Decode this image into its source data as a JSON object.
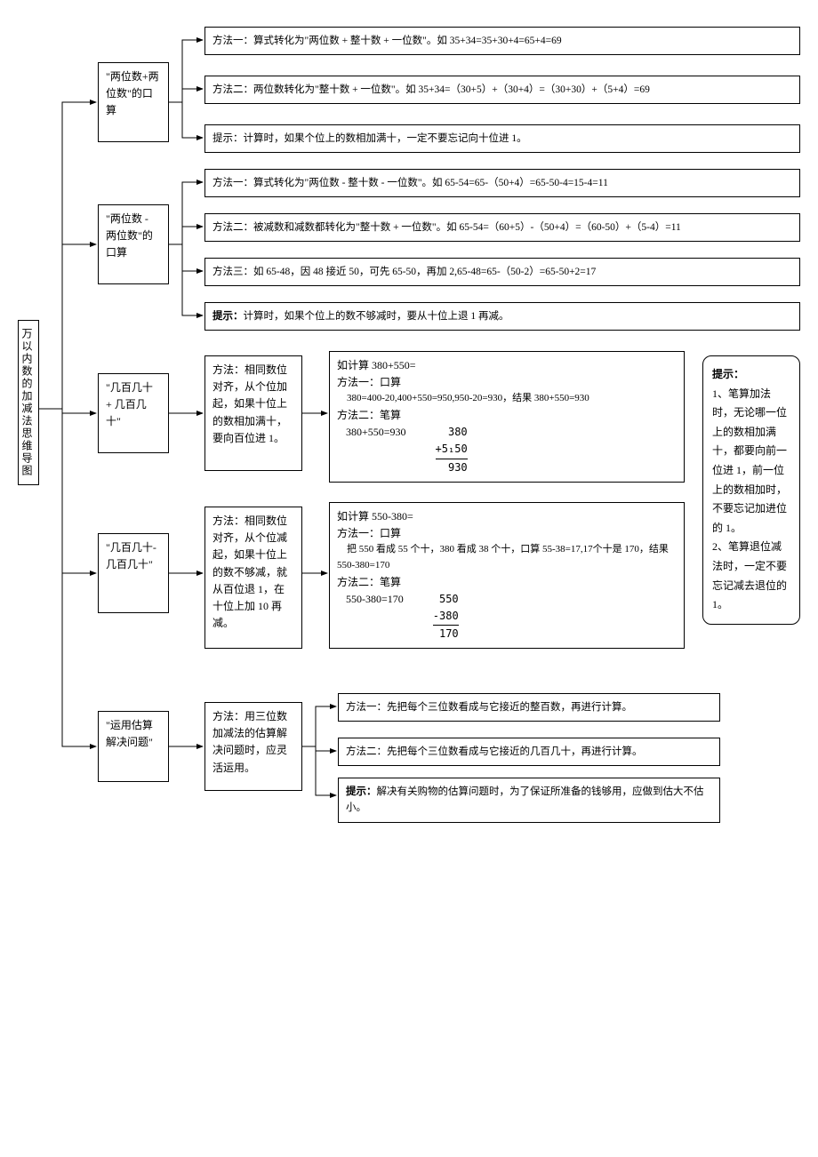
{
  "root": "万以内数的加减法思维导图",
  "n1": {
    "title": "\"两位数+两位数\"的口算",
    "m1": "方法一：算式转化为\"两位数 + 整十数 + 一位数\"。如 35+34=35+30+4=65+4=69",
    "m2": "方法二：两位数转化为\"整十数 + 一位数\"。如 35+34=（30+5）+（30+4）=（30+30）+（5+4）=69",
    "tip": "提示：计算时，如果个位上的数相加满十，一定不要忘记向十位进 1。"
  },
  "n2": {
    "title": "\"两位数 - 两位数\"的口算",
    "m1": "方法一：算式转化为\"两位数 - 整十数 - 一位数\"。如 65-54=65-（50+4）=65-50-4=15-4=11",
    "m2": "方法二：被减数和减数都转化为\"整十数 + 一位数\"。如 65-54=（60+5）-（50+4）=（60-50）+（5-4）=11",
    "m3": "方法三：如 65-48，因 48 接近 50，可先 65-50，再加 2,65-48=65-（50-2）=65-50+2=17",
    "tip_label": "提示：",
    "tip": "计算时，如果个位上的数不够减时，要从十位上退 1 再减。"
  },
  "n3": {
    "title": "\"几百几十 + 几百几十\"",
    "method": "方法：相同数位对齐，从个位加起，如果十位上的数相加满十，要向百位进 1。",
    "ex_title": "如计算 380+550=",
    "ex_m1_label": "方法一：口算",
    "ex_m1": "　380=400-20,400+550=950,950-20=930，结果 380+550=930",
    "ex_m2_label": "方法二：笔算",
    "ex_inline": "380+550=930",
    "col1": "380",
    "col2": "+5₁50",
    "col3": "930"
  },
  "n4": {
    "title": "\"几百几十-几百几十\"",
    "method": "方法：相同数位对齐，从个位减起，如果十位上的数不够减，就从百位退 1，在十位上加 10 再减。",
    "ex_title": "如计算 550-380=",
    "ex_m1_label": "方法一：口算",
    "ex_m1": "　把 550 看成 55 个十，380 看成 38 个十，口算 55-38=17,17个十是 170，结果 550-380=170",
    "ex_m2_label": "方法二：笔算",
    "ex_inline": "550-380=170",
    "col1": "550",
    "col2": "-380",
    "col3": "170"
  },
  "n5": {
    "title": "\"运用估算解决问题\"",
    "method": "方法：用三位数加减法的估算解决问题时，应灵活运用。",
    "m1": "方法一：先把每个三位数看成与它接近的整百数，再进行计算。",
    "m2": "方法二：先把每个三位数看成与它接近的几百几十，再进行计算。",
    "tip_label": "提示：",
    "tip": "解决有关购物的估算问题时，为了保证所准备的钱够用，应做到估大不估小。"
  },
  "side_tip": {
    "label": "提示：",
    "t1": "1、笔算加法时，无论哪一位上的数相加满十，都要向前一位进 1，前一位上的数相加时，不要忘记加进位的 1。",
    "t2": "2、笔算退位减法时，一定不要忘记减去退位的 1。"
  }
}
